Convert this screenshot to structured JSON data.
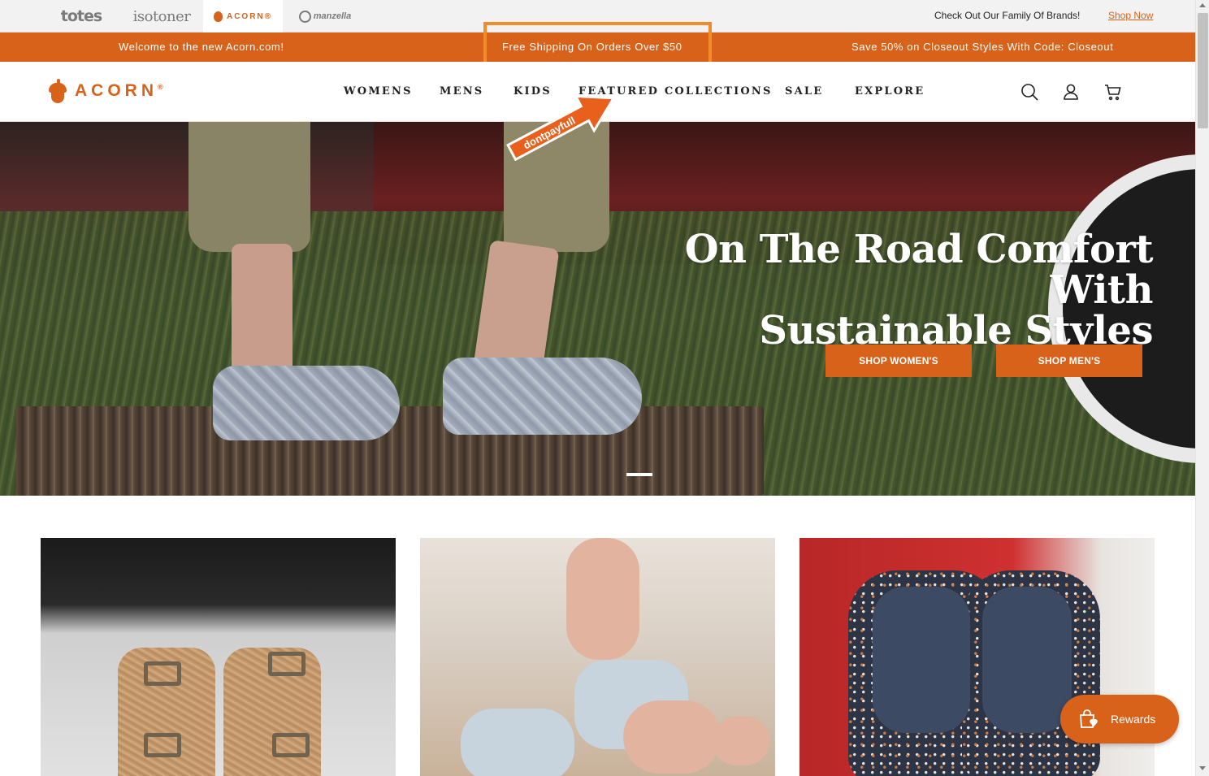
{
  "brand_bar": {
    "brands": [
      {
        "name": "totes"
      },
      {
        "name": "isotoner"
      },
      {
        "name": "ACORN®"
      },
      {
        "name": "manzella"
      }
    ],
    "family_text": "Check Out Our Family Of Brands!",
    "family_link": "Shop Now"
  },
  "promo_bar": {
    "messages": [
      "Welcome to the new Acorn.com!",
      "Free Shipping On Orders Over $50",
      "Save 50% on Closeout Styles With Code: Closeout"
    ],
    "accent_color": "#d9621b"
  },
  "header": {
    "logo_text": "ACORN",
    "logo_mark": "®",
    "nav": [
      "WOMENS",
      "MENS",
      "KIDS",
      "FEATURED COLLECTIONS",
      "SALE",
      "EXPLORE"
    ],
    "icons": [
      "search-icon",
      "account-icon",
      "cart-icon"
    ]
  },
  "watermark": {
    "sticker_text": "dontpayfull"
  },
  "hero": {
    "title_line1": "On The Road Comfort With",
    "title_line2": "Sustainable Styles",
    "buttons": [
      "SHOP WOMEN'S",
      "SHOP MEN'S"
    ],
    "slide_index": 1
  },
  "tiles": [
    {
      "name": "cork-sandal-tile"
    },
    {
      "name": "fleece-flip-flop-tile"
    },
    {
      "name": "knit-slipper-tile"
    }
  ],
  "rewards": {
    "label": "Rewards"
  }
}
